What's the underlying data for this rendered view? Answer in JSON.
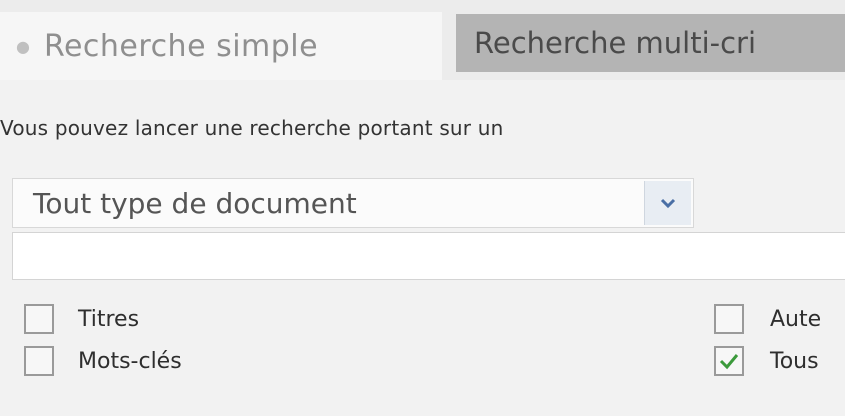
{
  "tabs": {
    "simple_label": "Recherche simple",
    "multi_label": "Recherche multi-cri"
  },
  "intro_text": "Vous pouvez lancer une recherche portant sur un",
  "doc_type_select": {
    "selected": "Tout type de document"
  },
  "search": {
    "value": ""
  },
  "options": [
    {
      "label": "Titres",
      "checked": false
    },
    {
      "label": "Mots-clés",
      "checked": false
    },
    {
      "label": "Aute",
      "checked": false
    },
    {
      "label": "Tous",
      "checked": true
    }
  ],
  "colors": {
    "check_mark": "#3c9a3c",
    "inactive_tab": "#b4b4b4",
    "select_arrow": "#4a6fa5"
  },
  "icons": {
    "tab_bullet": "bullet-icon",
    "select_arrow": "chevron-down-icon",
    "check": "check-icon"
  }
}
